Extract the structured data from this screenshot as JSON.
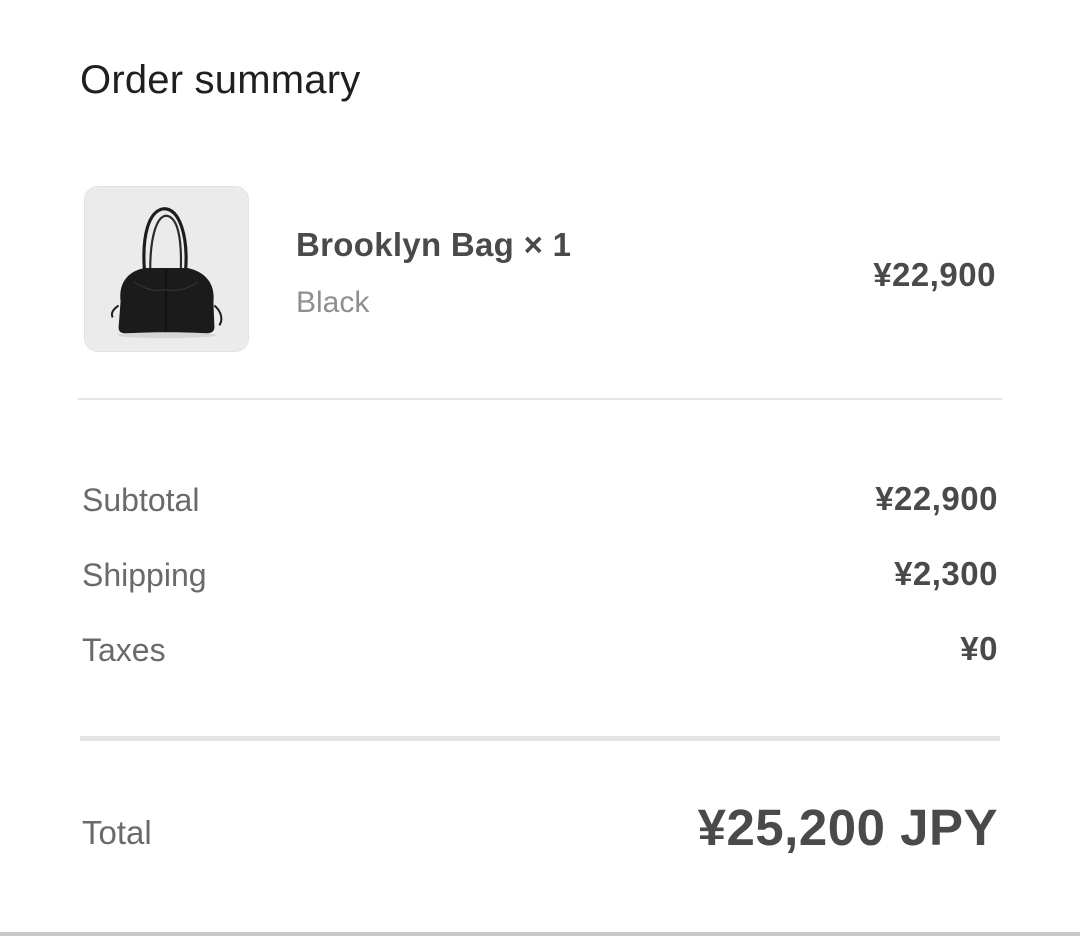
{
  "header": {
    "title": "Order summary"
  },
  "item": {
    "image_icon": "black-tote-bag",
    "name": "Brooklyn Bag × 1",
    "variant": "Black",
    "price": "¥22,900"
  },
  "summary": {
    "rows": [
      {
        "label": "Subtotal",
        "value": "¥22,900"
      },
      {
        "label": "Shipping",
        "value": "¥2,300"
      },
      {
        "label": "Taxes",
        "value": "¥0"
      }
    ],
    "total_label": "Total",
    "total_value": "¥25,200 JPY"
  },
  "colors": {
    "text_primary": "#4a4a4a",
    "text_secondary": "#8f8f8f",
    "divider": "#e5e5e5"
  }
}
